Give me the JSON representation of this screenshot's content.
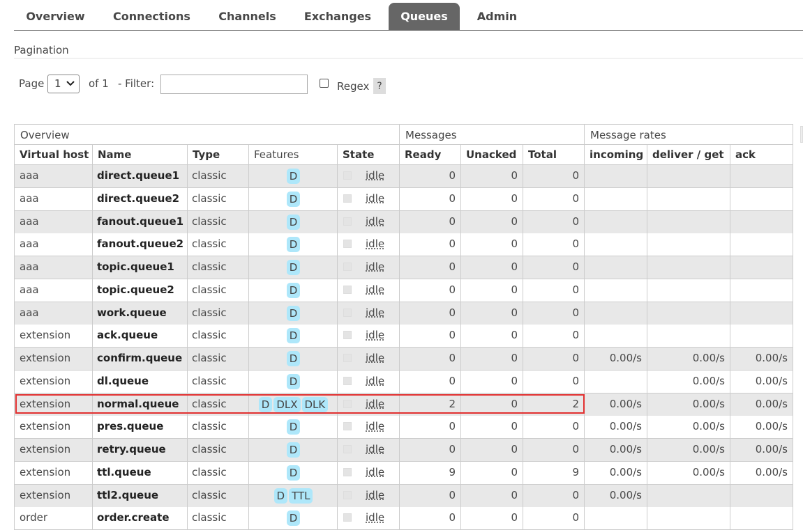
{
  "nav": {
    "tabs": [
      {
        "label": "Overview"
      },
      {
        "label": "Connections"
      },
      {
        "label": "Channels"
      },
      {
        "label": "Exchanges"
      },
      {
        "label": "Queues"
      },
      {
        "label": "Admin"
      }
    ],
    "active": "Queues"
  },
  "pagination": {
    "title": "Pagination",
    "page_label": "Page",
    "page_value": "1",
    "of_label": "of 1",
    "filter_label": "- Filter:",
    "filter_value": "",
    "regex_label": "Regex",
    "regex_checked": false,
    "help_label": "?"
  },
  "table": {
    "group_headers": {
      "overview": "Overview",
      "messages": "Messages",
      "rates": "Message rates"
    },
    "columns": {
      "vhost": "Virtual host",
      "name": "Name",
      "type": "Type",
      "features": "Features",
      "state": "State",
      "ready": "Ready",
      "unacked": "Unacked",
      "total": "Total",
      "incoming": "incoming",
      "deliver": "deliver / get",
      "ack": "ack"
    },
    "rows": [
      {
        "vhost": "aaa",
        "name": "direct.queue1",
        "type": "classic",
        "features": [
          "D"
        ],
        "state": "idle",
        "ready": "0",
        "unacked": "0",
        "total": "0",
        "incoming": "",
        "deliver": "",
        "ack": ""
      },
      {
        "vhost": "aaa",
        "name": "direct.queue2",
        "type": "classic",
        "features": [
          "D"
        ],
        "state": "idle",
        "ready": "0",
        "unacked": "0",
        "total": "0",
        "incoming": "",
        "deliver": "",
        "ack": ""
      },
      {
        "vhost": "aaa",
        "name": "fanout.queue1",
        "type": "classic",
        "features": [
          "D"
        ],
        "state": "idle",
        "ready": "0",
        "unacked": "0",
        "total": "0",
        "incoming": "",
        "deliver": "",
        "ack": ""
      },
      {
        "vhost": "aaa",
        "name": "fanout.queue2",
        "type": "classic",
        "features": [
          "D"
        ],
        "state": "idle",
        "ready": "0",
        "unacked": "0",
        "total": "0",
        "incoming": "",
        "deliver": "",
        "ack": ""
      },
      {
        "vhost": "aaa",
        "name": "topic.queue1",
        "type": "classic",
        "features": [
          "D"
        ],
        "state": "idle",
        "ready": "0",
        "unacked": "0",
        "total": "0",
        "incoming": "",
        "deliver": "",
        "ack": ""
      },
      {
        "vhost": "aaa",
        "name": "topic.queue2",
        "type": "classic",
        "features": [
          "D"
        ],
        "state": "idle",
        "ready": "0",
        "unacked": "0",
        "total": "0",
        "incoming": "",
        "deliver": "",
        "ack": ""
      },
      {
        "vhost": "aaa",
        "name": "work.queue",
        "type": "classic",
        "features": [
          "D"
        ],
        "state": "idle",
        "ready": "0",
        "unacked": "0",
        "total": "0",
        "incoming": "",
        "deliver": "",
        "ack": ""
      },
      {
        "vhost": "extension",
        "name": "ack.queue",
        "type": "classic",
        "features": [
          "D"
        ],
        "state": "idle",
        "ready": "0",
        "unacked": "0",
        "total": "0",
        "incoming": "",
        "deliver": "",
        "ack": ""
      },
      {
        "vhost": "extension",
        "name": "confirm.queue",
        "type": "classic",
        "features": [
          "D"
        ],
        "state": "idle",
        "ready": "0",
        "unacked": "0",
        "total": "0",
        "incoming": "0.00/s",
        "deliver": "0.00/s",
        "ack": "0.00/s"
      },
      {
        "vhost": "extension",
        "name": "dl.queue",
        "type": "classic",
        "features": [
          "D"
        ],
        "state": "idle",
        "ready": "0",
        "unacked": "0",
        "total": "0",
        "incoming": "",
        "deliver": "0.00/s",
        "ack": "0.00/s"
      },
      {
        "vhost": "extension",
        "name": "normal.queue",
        "type": "classic",
        "features": [
          "D",
          "DLX",
          "DLK"
        ],
        "state": "idle",
        "ready": "2",
        "unacked": "0",
        "total": "2",
        "incoming": "0.00/s",
        "deliver": "0.00/s",
        "ack": "0.00/s",
        "highlighted": true
      },
      {
        "vhost": "extension",
        "name": "pres.queue",
        "type": "classic",
        "features": [
          "D"
        ],
        "state": "idle",
        "ready": "0",
        "unacked": "0",
        "total": "0",
        "incoming": "0.00/s",
        "deliver": "0.00/s",
        "ack": "0.00/s"
      },
      {
        "vhost": "extension",
        "name": "retry.queue",
        "type": "classic",
        "features": [
          "D"
        ],
        "state": "idle",
        "ready": "0",
        "unacked": "0",
        "total": "0",
        "incoming": "0.00/s",
        "deliver": "0.00/s",
        "ack": "0.00/s"
      },
      {
        "vhost": "extension",
        "name": "ttl.queue",
        "type": "classic",
        "features": [
          "D"
        ],
        "state": "idle",
        "ready": "9",
        "unacked": "0",
        "total": "9",
        "incoming": "0.00/s",
        "deliver": "0.00/s",
        "ack": "0.00/s"
      },
      {
        "vhost": "extension",
        "name": "ttl2.queue",
        "type": "classic",
        "features": [
          "D",
          "TTL"
        ],
        "state": "idle",
        "ready": "0",
        "unacked": "0",
        "total": "0",
        "incoming": "0.00/s",
        "deliver": "",
        "ack": ""
      },
      {
        "vhost": "order",
        "name": "order.create",
        "type": "classic",
        "features": [
          "D"
        ],
        "state": "idle",
        "ready": "0",
        "unacked": "0",
        "total": "0",
        "incoming": "",
        "deliver": "",
        "ack": ""
      }
    ]
  },
  "colors": {
    "tab_active_bg": "#666666",
    "badge_bg": "#aee7fa",
    "highlight_border": "#e23030",
    "row_alt_bg": "#e8e8e8"
  }
}
